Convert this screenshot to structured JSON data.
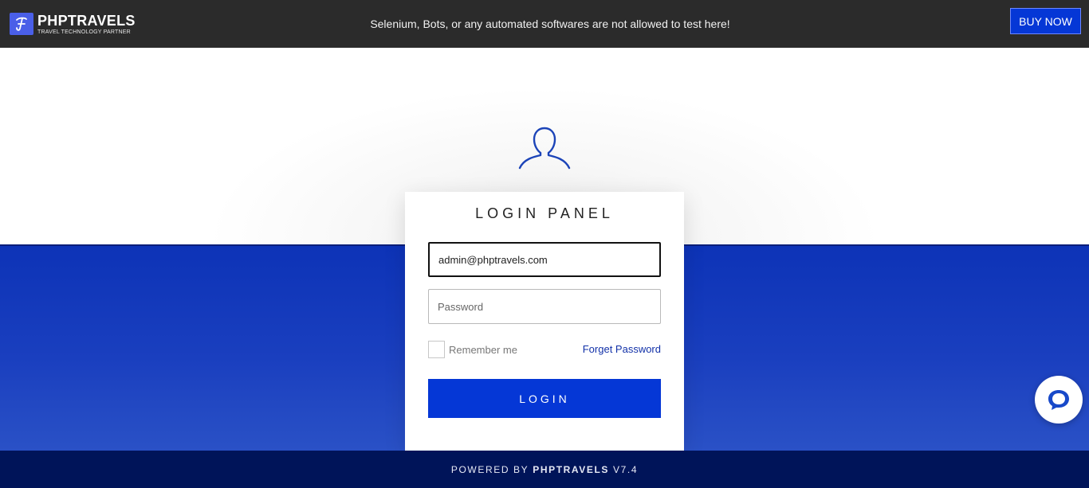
{
  "header": {
    "brand_name": "PHPTRAVELS",
    "brand_tagline": "TRAVEL TECHNOLOGY PARTNER",
    "notice": "Selenium, Bots, or any automated softwares are not allowed to test here!",
    "buy_label": "BUY NOW"
  },
  "login": {
    "title": "LOGIN PANEL",
    "email_value": "admin@phptravels.com",
    "password_placeholder": "Password",
    "remember_label": "Remember me",
    "forget_label": "Forget Password",
    "login_label": "LOGIN"
  },
  "footer": {
    "prefix": "POWERED BY",
    "brand": "PHPTRAVELS",
    "version": "V7.4"
  },
  "icons": {
    "brand": "brand-logo-icon",
    "user": "user-icon",
    "chat": "chat-icon"
  },
  "colors": {
    "accent": "#0537d6",
    "topbar": "#2b2b2b",
    "footer": "#001459",
    "link": "#1231a8"
  }
}
